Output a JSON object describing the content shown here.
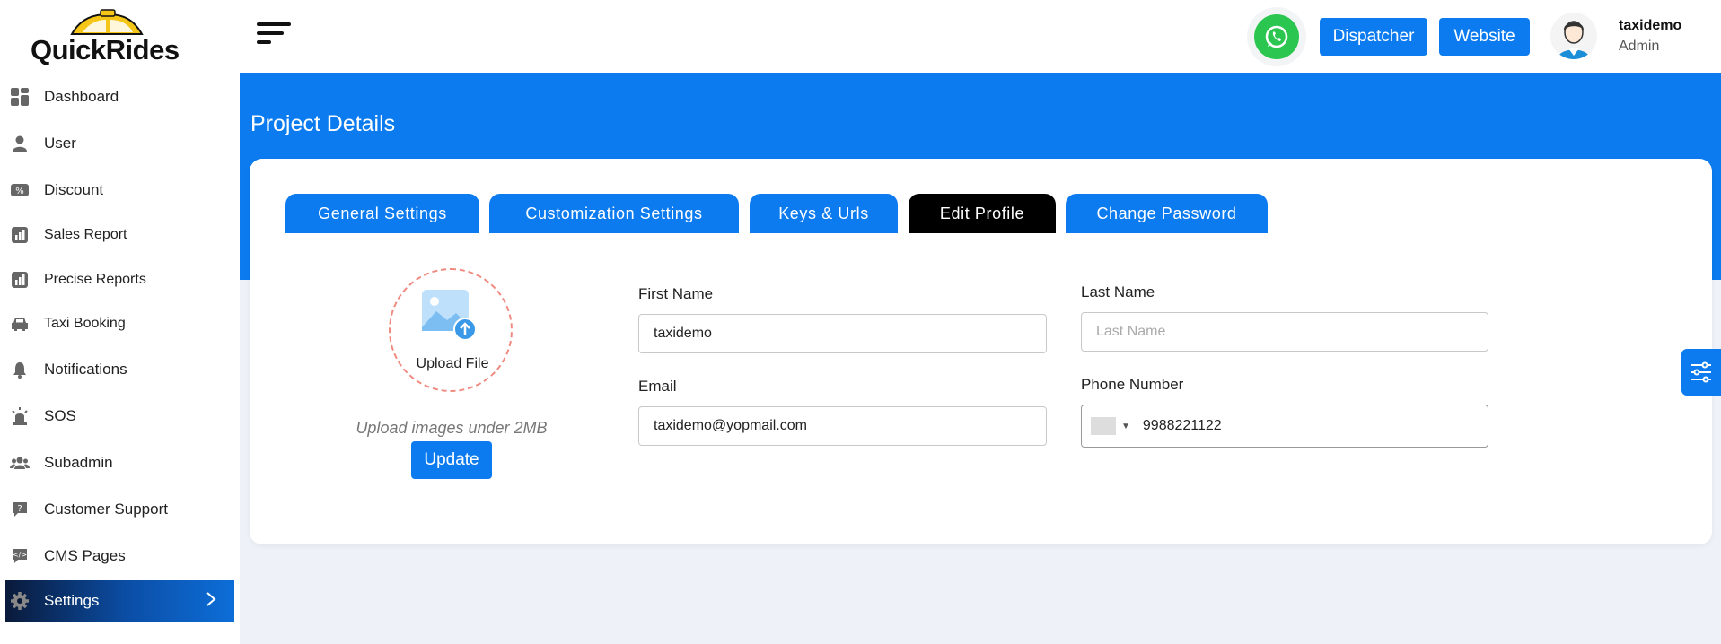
{
  "brand": {
    "name": "QuickRides"
  },
  "sidebar": {
    "items": [
      {
        "label": "Dashboard",
        "icon": "dashboard-icon"
      },
      {
        "label": "User",
        "icon": "user-icon"
      },
      {
        "label": "Discount",
        "icon": "discount-icon"
      },
      {
        "label": "Sales Report",
        "icon": "chart-icon"
      },
      {
        "label": "Precise Reports",
        "icon": "chart-icon"
      },
      {
        "label": "Taxi Booking",
        "icon": "car-icon"
      },
      {
        "label": "Notifications",
        "icon": "bell-icon"
      },
      {
        "label": "SOS",
        "icon": "siren-icon"
      },
      {
        "label": "Subadmin",
        "icon": "users-icon"
      },
      {
        "label": "Customer Support",
        "icon": "support-icon"
      },
      {
        "label": "CMS Pages",
        "icon": "cms-icon"
      },
      {
        "label": "Settings",
        "icon": "gear-icon",
        "active": true
      }
    ]
  },
  "header": {
    "dispatcher_label": "Dispatcher",
    "website_label": "Website",
    "user_name": "taxidemo",
    "user_role": "Admin"
  },
  "page": {
    "title": "Project Details"
  },
  "tabs": [
    {
      "label": "General Settings"
    },
    {
      "label": "Customization Settings"
    },
    {
      "label": "Keys & Urls"
    },
    {
      "label": "Edit Profile",
      "active": true
    },
    {
      "label": "Change Password"
    }
  ],
  "profile": {
    "upload_label": "Upload File",
    "upload_hint": "Upload images under 2MB",
    "update_label": "Update",
    "first_name_label": "First Name",
    "first_name_value": "taxidemo",
    "last_name_label": "Last Name",
    "last_name_placeholder": "Last Name",
    "email_label": "Email",
    "email_value": "taxidemo@yopmail.com",
    "phone_label": "Phone Number",
    "phone_value": "9988221122"
  },
  "colors": {
    "primary": "#0b7bef",
    "active_tab": "#000000",
    "whatsapp": "#2bc64f",
    "dashed_border": "#f08a80"
  }
}
